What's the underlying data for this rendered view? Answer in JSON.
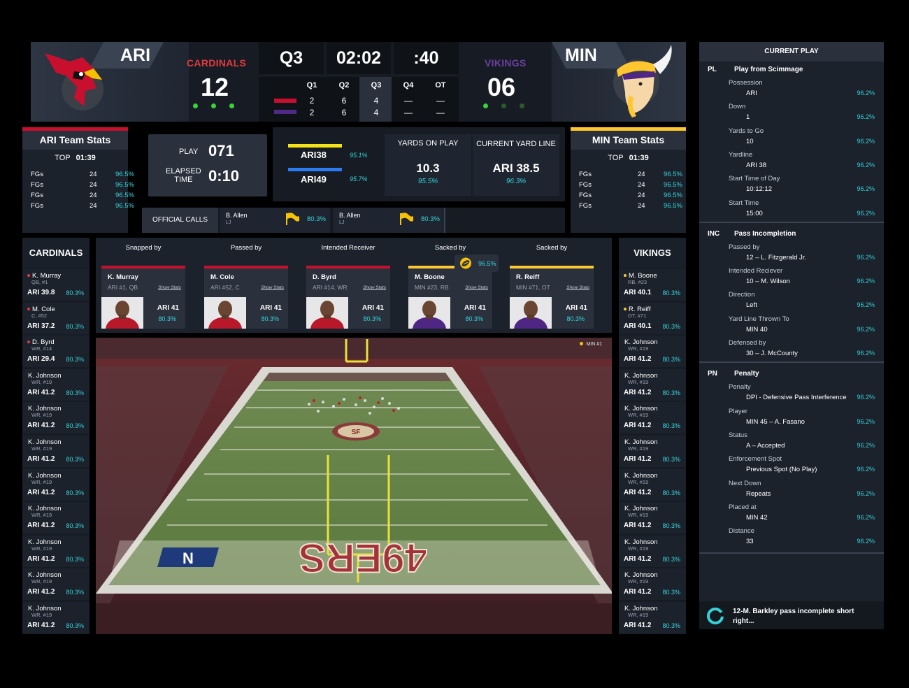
{
  "scoreboard": {
    "home": {
      "abbr": "ARI",
      "name": "CARDINALS",
      "score": "12",
      "color": "#c8102e",
      "timeouts": 3
    },
    "away": {
      "abbr": "MIN",
      "name": "VIKINGS",
      "score": "06",
      "color": "#6b3fa0",
      "timeouts": 1
    },
    "quarter": "Q3",
    "clock": "02:02",
    "play_clock": ":40",
    "quarter_headers": [
      "Q1",
      "Q2",
      "Q3",
      "Q4",
      "OT"
    ],
    "quarter_scores": {
      "home": [
        "2",
        "6",
        "4",
        "—",
        "—"
      ],
      "away": [
        "2",
        "6",
        "4",
        "—",
        "—"
      ]
    }
  },
  "ari_stats": {
    "title": "ARI Team Stats",
    "top_label": "TOP",
    "top_value": "01:39",
    "rows": [
      {
        "l": "FGs",
        "v": "24",
        "p": "96.5%"
      },
      {
        "l": "FGs",
        "v": "24",
        "p": "96.5%"
      },
      {
        "l": "FGs",
        "v": "24",
        "p": "96.5%"
      },
      {
        "l": "FGs",
        "v": "24",
        "p": "96.5%"
      }
    ]
  },
  "min_stats": {
    "title": "MIN Team Stats",
    "top_label": "TOP",
    "top_value": "01:39",
    "rows": [
      {
        "l": "FGs",
        "v": "24",
        "p": "96.5%"
      },
      {
        "l": "FGs",
        "v": "24",
        "p": "96.5%"
      },
      {
        "l": "FGs",
        "v": "24",
        "p": "96.5%"
      },
      {
        "l": "FGs",
        "v": "24",
        "p": "96.5%"
      }
    ]
  },
  "play": {
    "play_label": "PLAY",
    "play_value": "071",
    "elapsed_label_1": "ELAPSED",
    "elapsed_label_2": "TIME",
    "elapsed_value": "0:10"
  },
  "lines": [
    {
      "label": "ARI38",
      "pct": "95.1%",
      "color": "#f5e11a"
    },
    {
      "label": "ARI49",
      "pct": "95.7%",
      "color": "#2b7bf0"
    }
  ],
  "yards": {
    "yards_label": "YARDS ON PLAY",
    "yards_value": "10.3",
    "yards_pct": "95.5%",
    "line_label": "CURRENT YARD LINE",
    "line_value": "ARI 38.5",
    "line_pct": "96.3%"
  },
  "official_calls": {
    "label": "OFFICIAL CALLS",
    "calls": [
      {
        "name": "B. Allen",
        "pos": "LJ",
        "pct": "80.3%"
      },
      {
        "name": "B. Allen",
        "pos": "LJ",
        "pct": "80.3%"
      }
    ]
  },
  "cardinals_roster": {
    "title": "CARDINALS",
    "players": [
      {
        "name": "K. Murray",
        "pos": "QB, #1",
        "yard": "ARI 39.8",
        "pct": "80.3%",
        "flag": true
      },
      {
        "name": "M. Cole",
        "pos": "C, #52",
        "yard": "ARI 37.2",
        "pct": "80.3%",
        "flag": true
      },
      {
        "name": "D. Byrd",
        "pos": "WR, #14",
        "yard": "ARI 29.4",
        "pct": "80.3%",
        "flag": true
      },
      {
        "name": "K. Johnson",
        "pos": "WR, #19",
        "yard": "ARI 41.2",
        "pct": "80.3%",
        "flag": false
      },
      {
        "name": "K. Johnson",
        "pos": "WR, #19",
        "yard": "ARI 41.2",
        "pct": "80.3%",
        "flag": false
      },
      {
        "name": "K. Johnson",
        "pos": "WR, #19",
        "yard": "ARI 41.2",
        "pct": "80.3%",
        "flag": false
      },
      {
        "name": "K. Johnson",
        "pos": "WR, #19",
        "yard": "ARI 41.2",
        "pct": "80.3%",
        "flag": false
      },
      {
        "name": "K. Johnson",
        "pos": "WR, #19",
        "yard": "ARI 41.2",
        "pct": "80.3%",
        "flag": false
      },
      {
        "name": "K. Johnson",
        "pos": "WR, #19",
        "yard": "ARI 41.2",
        "pct": "80.3%",
        "flag": false
      },
      {
        "name": "K. Johnson",
        "pos": "WR, #19",
        "yard": "ARI 41.2",
        "pct": "80.3%",
        "flag": false
      },
      {
        "name": "K. Johnson",
        "pos": "WR, #19",
        "yard": "ARI 41.2",
        "pct": "80.3%",
        "flag": false
      }
    ]
  },
  "vikings_roster": {
    "title": "VIKINGS",
    "players": [
      {
        "name": "M. Boone",
        "pos": "RB, #23",
        "yard": "ARI 40.1",
        "pct": "80.3%",
        "flag": true
      },
      {
        "name": "R. Reiff",
        "pos": "OT, #71",
        "yard": "ARI 40.1",
        "pct": "80.3%",
        "flag": true
      },
      {
        "name": "K. Johnson",
        "pos": "WR, #19",
        "yard": "ARI 41.2",
        "pct": "80.3%",
        "flag": false
      },
      {
        "name": "K. Johnson",
        "pos": "WR, #19",
        "yard": "ARI 41.2",
        "pct": "80.3%",
        "flag": false
      },
      {
        "name": "K. Johnson",
        "pos": "WR, #19",
        "yard": "ARI 41.2",
        "pct": "80.3%",
        "flag": false
      },
      {
        "name": "K. Johnson",
        "pos": "WR, #19",
        "yard": "ARI 41.2",
        "pct": "80.3%",
        "flag": false
      },
      {
        "name": "K. Johnson",
        "pos": "WR, #19",
        "yard": "ARI 41.2",
        "pct": "80.3%",
        "flag": false
      },
      {
        "name": "K. Johnson",
        "pos": "WR, #19",
        "yard": "ARI 41.2",
        "pct": "80.3%",
        "flag": false
      },
      {
        "name": "K. Johnson",
        "pos": "WR, #19",
        "yard": "ARI 41.2",
        "pct": "80.3%",
        "flag": false
      },
      {
        "name": "K. Johnson",
        "pos": "WR, #19",
        "yard": "ARI 41.2",
        "pct": "80.3%",
        "flag": false
      },
      {
        "name": "K. Johnson",
        "pos": "WR, #19",
        "yard": "ARI 41.2",
        "pct": "80.3%",
        "flag": false
      }
    ]
  },
  "involvement": [
    {
      "role": "Snapped by",
      "name": "K. Murray",
      "sub": "ARI #1, QB",
      "yard": "ARI 41",
      "pct": "80.3%",
      "team": "ARI",
      "show": "Show Stats"
    },
    {
      "role": "Passed by",
      "name": "M. Cole",
      "sub": "ARI #52, C",
      "yard": "ARI 41",
      "pct": "80.3%",
      "team": "ARI",
      "show": "Show Stats"
    },
    {
      "role": "Intended Receiver",
      "name": "D. Byrd",
      "sub": "ARI #14, WR",
      "yard": "ARI 41",
      "pct": "80.3%",
      "team": "ARI",
      "show": "Show Stats"
    },
    {
      "role": "Sacked by",
      "name": "M. Boone",
      "sub": "MIN #23, RB",
      "yard": "ARI 41",
      "pct": "80.3%",
      "team": "MIN",
      "show": "Show Stats"
    },
    {
      "role": "Sacked by",
      "name": "R. Reiff",
      "sub": "MIN #71, OT",
      "yard": "ARI 41",
      "pct": "80.3%",
      "team": "MIN",
      "show": "Show Stats"
    }
  ],
  "ball_badge": {
    "pct": "96.5%"
  },
  "field": {
    "overlay": "MIN #1",
    "endzone_text": "49ERS"
  },
  "current_play": {
    "title": "CURRENT PLAY",
    "sections": [
      {
        "code": "PL",
        "title": "Play from Scimmage",
        "items": [
          {
            "label": "Possession",
            "value": "ARI",
            "pct": "96.2%"
          },
          {
            "label": "Down",
            "value": "1",
            "pct": "96.2%"
          },
          {
            "label": "Yards to Go",
            "value": "10",
            "pct": "96.2%"
          },
          {
            "label": "Yardline",
            "value": "ARI 38",
            "pct": "96.2%"
          },
          {
            "label": "Start Time of Day",
            "value": "10:12:12",
            "pct": "96.2%"
          },
          {
            "label": "Start Time",
            "value": "15:00",
            "pct": "96.2%"
          }
        ]
      },
      {
        "code": "INC",
        "title": "Pass Incompletion",
        "items": [
          {
            "label": "Passed by",
            "value": "12 – L. Fitzgerald Jr.",
            "pct": "96.2%"
          },
          {
            "label": "Intended Reciever",
            "value": "10 – M. Wilson",
            "pct": "96.2%"
          },
          {
            "label": "Direction",
            "value": "Left",
            "pct": "96.2%"
          },
          {
            "label": "Yard Line Thrown To",
            "value": "MIN 40",
            "pct": "96.2%"
          },
          {
            "label": "Defensed by",
            "value": "30 – J. McCounty",
            "pct": "96.2%"
          }
        ]
      },
      {
        "code": "PN",
        "title": "Penalty",
        "items": [
          {
            "label": "Penalty",
            "value": "DPI - Defensive Pass Interference",
            "pct": "96.2%"
          },
          {
            "label": "Player",
            "value": "MIN 45 – A. Fasano",
            "pct": "96.2%"
          },
          {
            "label": "Status",
            "value": "A – Accepted",
            "pct": "96.2%"
          },
          {
            "label": "Enforcement Spot",
            "value": "Previous Spot (No Play)",
            "pct": "96.2%"
          },
          {
            "label": "Next Down",
            "value": "Repeats",
            "pct": "96.2%"
          },
          {
            "label": "Placed at",
            "value": "MIN 42",
            "pct": "96.2%"
          },
          {
            "label": "Distance",
            "value": "33",
            "pct": "96.2%"
          }
        ]
      }
    ],
    "summary": "12-M. Barkley pass incomplete short right..."
  }
}
